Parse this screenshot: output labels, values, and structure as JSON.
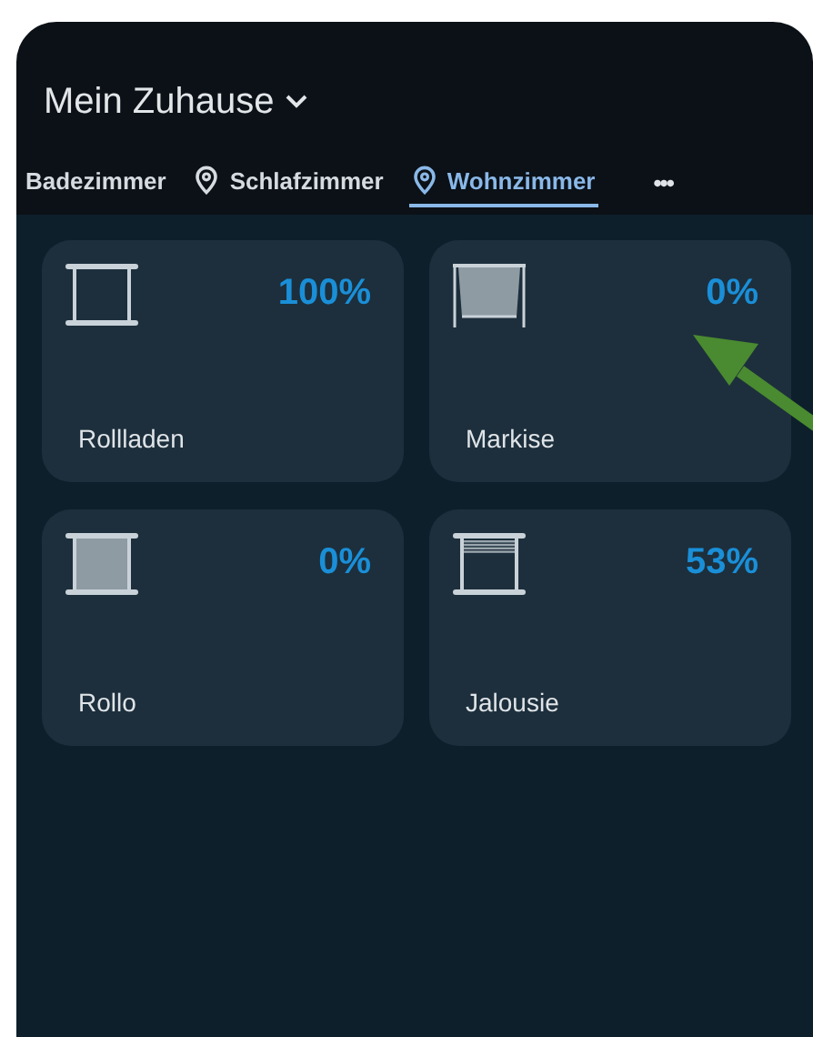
{
  "header": {
    "title": "Mein Zuhause"
  },
  "tabs": [
    {
      "label": "Badezimmer",
      "icon": false,
      "selected": false
    },
    {
      "label": "Schlafzimmer",
      "icon": true,
      "selected": false
    },
    {
      "label": "Wohnzimmer",
      "icon": true,
      "selected": true
    }
  ],
  "more_button": "•••",
  "devices": [
    {
      "name": "Rollladen",
      "kind": "shutter",
      "reading": "100%"
    },
    {
      "name": "Markise",
      "kind": "awning",
      "reading": "0%"
    },
    {
      "name": "Rollo",
      "kind": "roller",
      "reading": "0%"
    },
    {
      "name": "Jalousie",
      "kind": "blind",
      "reading": "53%"
    }
  ],
  "annotation": {
    "kind": "arrow",
    "color": "#4a8a30"
  }
}
